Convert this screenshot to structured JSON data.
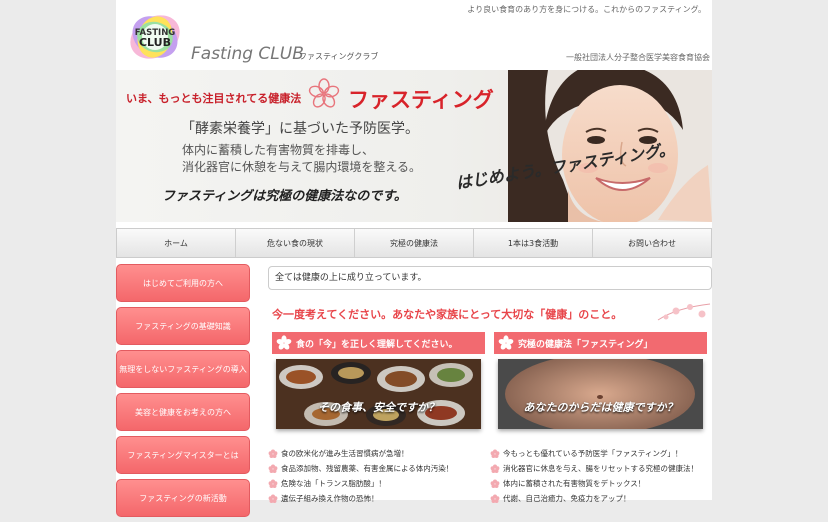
{
  "header": {
    "tagline": "より良い食育のあり方を身につける。これからのファスティング。",
    "logo_badge_line1": "FASTING",
    "logo_badge_line2": "CLUB",
    "logo_text": "Fasting CLUB",
    "logo_subtitle": "ファスティングクラブ",
    "association": "一般社団法人分子整合医学美容食育協会"
  },
  "hero": {
    "line1": "いま、もっとも注目されてる健康法",
    "title": "ファスティング",
    "line2": "「酵素栄養学」に基づいた予防医学。",
    "line3": "体内に蓄積した有害物質を排毒し、",
    "line4": "消化器官に休憩を与えて腸内環境を整える。",
    "line5": "ファスティングは究極の健康法なのです。",
    "slogan": "はじめよう。ファスティング。"
  },
  "nav": {
    "items": [
      "ホーム",
      "危ない食の現状",
      "究極の健康法",
      "1本は3食活動",
      "お問い合わせ"
    ]
  },
  "sidebar": {
    "items": [
      "はじめてご利用の方へ",
      "ファスティングの基礎知識",
      "無理をしないファスティングの導入",
      "美容と健康をお考えの方へ",
      "ファスティングマイスターとは",
      "ファスティングの新活動"
    ]
  },
  "main": {
    "notice": "全ては健康の上に成り立っています。",
    "headline": "今一度考えてください。あなたや家族にとって大切な「健康」のこと。",
    "cards": [
      {
        "title": "食の「今」を正しく理解してください。",
        "caption": "その食事、安全ですか？",
        "bullets": [
          "食の欧米化が進み生活習慣病が急増！",
          "食品添加物、残留農薬、有害金属による体内汚染！",
          "危険な油「トランス脂肪酸」！",
          "遺伝子組み換え作物の恐怖！"
        ]
      },
      {
        "title": "究極の健康法「ファスティング」",
        "caption": "あなたのからだは健康ですか？",
        "bullets": [
          "今もっとも優れている予防医学「ファスティング」！",
          "消化器官に休息を与え、腸をリセットする究極の健康法！",
          "体内に蓄積された有害物質をデトックス！",
          "代謝、自己治癒力、免疫力をアップ！"
        ]
      }
    ]
  },
  "colors": {
    "accent_red": "#d8232a",
    "sidebar_pink": "#f4676b",
    "card_title_pink": "#f26a70",
    "background_gray": "#ebebeb"
  }
}
